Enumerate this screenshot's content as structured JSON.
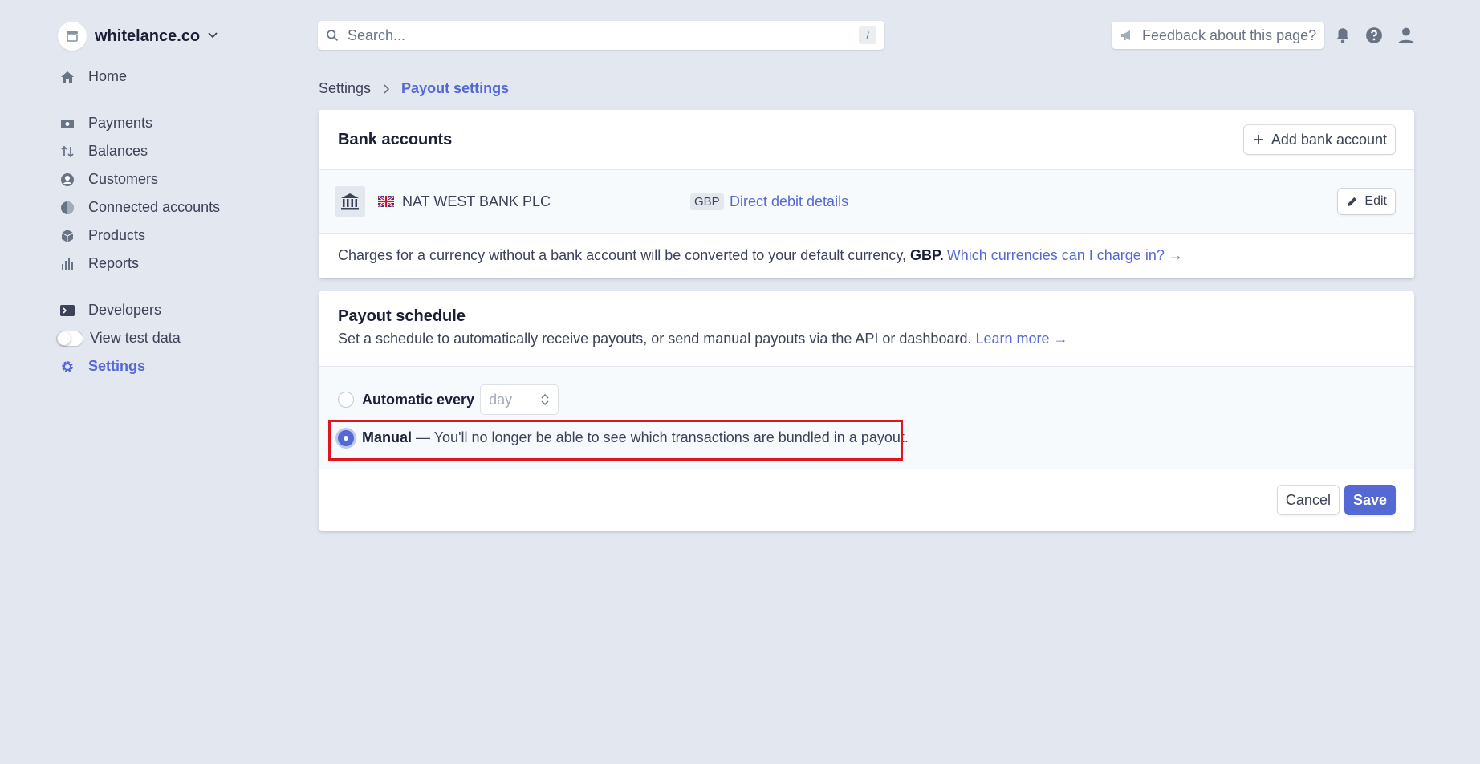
{
  "account": {
    "name": "whitelance.co"
  },
  "sidebar": {
    "items": [
      {
        "label": "Home",
        "icon": "home-icon"
      },
      {
        "label": "Payments",
        "icon": "payments-icon"
      },
      {
        "label": "Balances",
        "icon": "balances-icon"
      },
      {
        "label": "Customers",
        "icon": "customers-icon"
      },
      {
        "label": "Connected accounts",
        "icon": "connected-accounts-icon"
      },
      {
        "label": "Products",
        "icon": "products-icon"
      },
      {
        "label": "Reports",
        "icon": "reports-icon"
      },
      {
        "label": "Developers",
        "icon": "terminal-icon"
      },
      {
        "label": "View test data",
        "icon": "toggle"
      },
      {
        "label": "Settings",
        "icon": "gear-icon",
        "active": true
      }
    ]
  },
  "header": {
    "search_placeholder": "Search...",
    "search_shortcut": "/",
    "feedback_label": "Feedback about this page?"
  },
  "breadcrumb": {
    "root": "Settings",
    "current": "Payout settings"
  },
  "bank_accounts": {
    "title": "Bank accounts",
    "add_button": "Add bank account",
    "bank_name": "NAT WEST BANK PLC",
    "currency": "GBP",
    "direct_debit_link": "Direct debit details",
    "edit_button": "Edit",
    "note_prefix": "Charges for a currency without a bank account will be converted to your default currency,",
    "note_currency": "GBP.",
    "note_link": "Which currencies can I charge in? →"
  },
  "payout_schedule": {
    "title": "Payout schedule",
    "description": "Set a schedule to automatically receive payouts, or send manual payouts via the API or dashboard.",
    "learn_more": "Learn more →",
    "automatic_label": "Automatic every",
    "interval_value": "day",
    "manual_label": "Manual",
    "manual_note": " — You'll no longer be able to see which transactions are bundled in a payout.",
    "selected": "manual"
  },
  "actions": {
    "cancel": "Cancel",
    "save": "Save"
  },
  "colors": {
    "accent": "#5469d4",
    "background": "#e3e7ef",
    "highlight": "#e0141e"
  }
}
